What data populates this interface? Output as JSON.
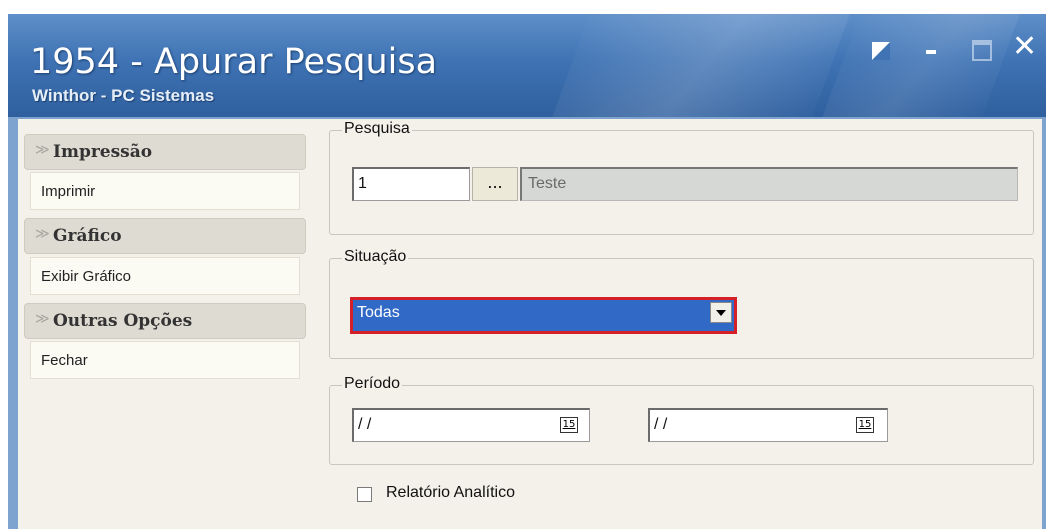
{
  "window": {
    "title": "1954 - Apurar Pesquisa",
    "subtitle": "Winthor - PC Sistemas"
  },
  "sidebar": {
    "sections": [
      {
        "header": "Impressão",
        "item": "Imprimir"
      },
      {
        "header": "Gráfico",
        "item": "Exibir Gráfico"
      },
      {
        "header": "Outras Opções",
        "item": "Fechar"
      }
    ]
  },
  "pesquisa": {
    "legend": "Pesquisa",
    "code_value": "1",
    "lookup_button": "...",
    "description": "Teste"
  },
  "situacao": {
    "legend": "Situação",
    "selected": "Todas"
  },
  "periodo": {
    "legend": "Período",
    "start_value": "/ /",
    "end_value": "/ /",
    "calendar_label": "15"
  },
  "relatorio": {
    "label": "Relatório Analítico",
    "checked": false
  }
}
